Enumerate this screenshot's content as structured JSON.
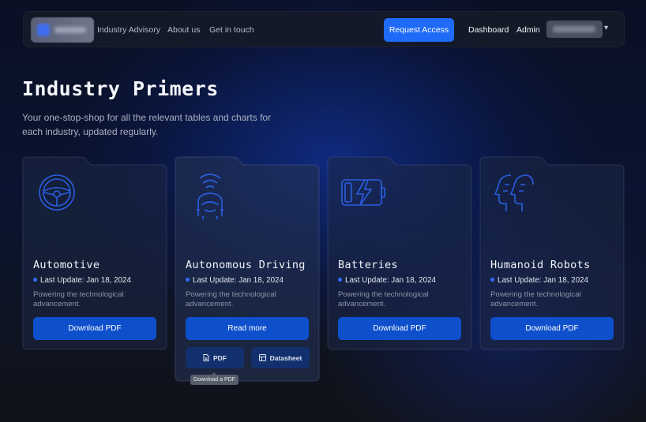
{
  "nav": {
    "links": [
      "Industry Advisory",
      "About us",
      "Get in touch"
    ],
    "request_access": "Request Access",
    "dashboard": "Dashboard",
    "admin": "Admin",
    "chevron": "▾"
  },
  "hero": {
    "title": "Industry Primers",
    "subtitle": "Your one-stop-shop for all the relevant tables and charts for each industry, updated regularly."
  },
  "cards": [
    {
      "title": "Automotive",
      "update": "Last Update: Jan 18, 2024",
      "desc": "Powering the technological advancement.",
      "button": "Download PDF",
      "icon": "steering-wheel-icon"
    },
    {
      "title": "Autonomous Driving",
      "update": "Last Update: Jan 18, 2024",
      "desc": "Powering the technological advancement.",
      "button": "Read more",
      "icon": "car-signal-icon",
      "sub_buttons": [
        "PDF",
        "Datasheet"
      ]
    },
    {
      "title": "Batteries",
      "update": "Last Update: Jan 18, 2024",
      "desc": "Powering the technological advancement.",
      "button": "Download PDF",
      "icon": "battery-charging-icon"
    },
    {
      "title": "Humanoid Robots",
      "update": "Last Update: Jan 18, 2024",
      "desc": "Powering the technological advancement.",
      "button": "Download PDF",
      "icon": "robot-heads-icon"
    }
  ],
  "tooltip": "Download a PDF",
  "colors": {
    "accent": "#1f6af7",
    "button": "#0e4fcc",
    "icon_stroke": "#2a5fe0"
  }
}
